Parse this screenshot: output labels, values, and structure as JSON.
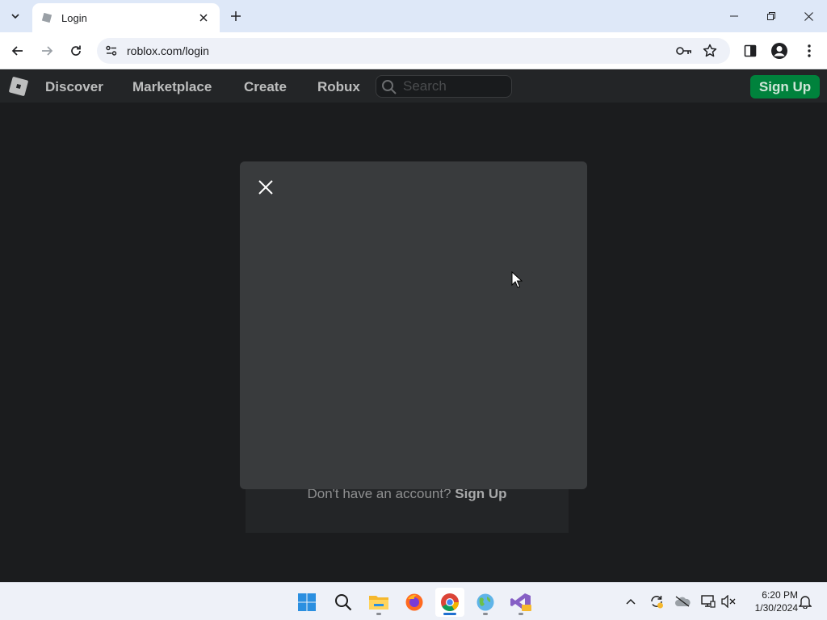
{
  "browser": {
    "tab_title": "Login",
    "url": "roblox.com/login"
  },
  "nav": {
    "links": [
      "Discover",
      "Marketplace",
      "Create",
      "Robux"
    ],
    "search_placeholder": "Search",
    "signup_label": "Sign Up"
  },
  "page": {
    "account_prompt": "Don't have an account?",
    "account_link": "Sign Up"
  },
  "taskbar": {
    "time": "6:20 PM",
    "date": "1/30/2024",
    "apps": [
      "start-icon",
      "search-icon",
      "file-explorer-icon",
      "firefox-icon",
      "chrome-icon",
      "earth-app-icon",
      "visual-studio-icon"
    ]
  },
  "colors": {
    "page_bg": "#1b1c1e",
    "nav_bg": "#232527",
    "modal_bg": "#393b3d",
    "signup_green": "#00823c"
  }
}
